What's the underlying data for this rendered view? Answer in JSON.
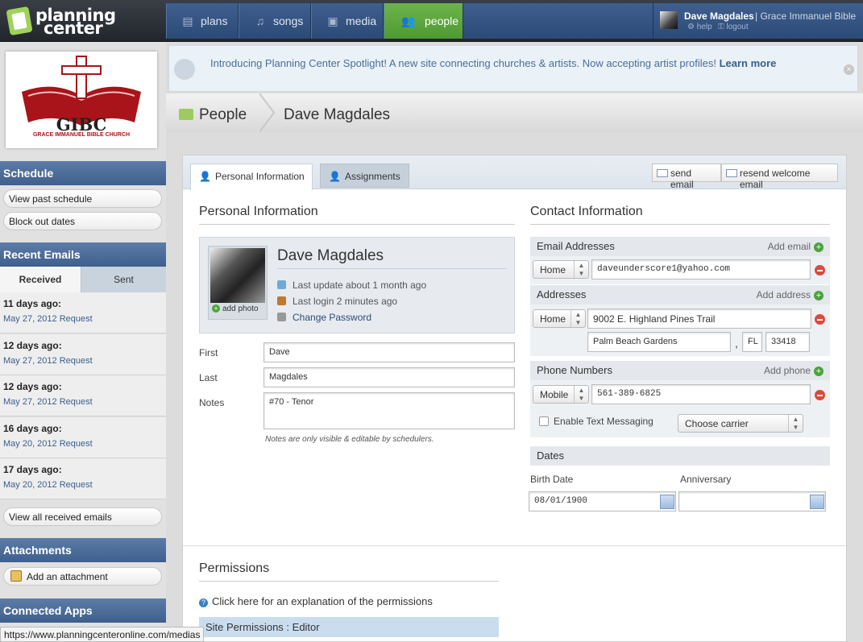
{
  "brand": {
    "line1": "planning",
    "line2": "center"
  },
  "nav": {
    "tabs": [
      {
        "label": "plans"
      },
      {
        "label": "songs"
      },
      {
        "label": "media"
      },
      {
        "label": "people"
      }
    ],
    "user_name": "Dave Magdales",
    "org": "Grace Immanuel Bible",
    "help": "help",
    "logout": "logout"
  },
  "sidebar": {
    "church_logo_text": "GIBC",
    "church_logo_sub": "GRACE IMMANUEL BIBLE CHURCH",
    "schedule_title": "Schedule",
    "view_past_schedule": "View past schedule",
    "block_out_dates": "Block out dates",
    "recent_emails_title": "Recent Emails",
    "tab_received": "Received",
    "tab_sent": "Sent",
    "emails": [
      {
        "ago": "11 days ago:",
        "subject": "May 27, 2012 Request"
      },
      {
        "ago": "12 days ago:",
        "subject": "May 27, 2012 Request"
      },
      {
        "ago": "12 days ago:",
        "subject": "May 27, 2012 Request"
      },
      {
        "ago": "16 days ago:",
        "subject": "May 20, 2012 Request"
      },
      {
        "ago": "17 days ago:",
        "subject": "May 20, 2012 Request"
      }
    ],
    "view_all_emails": "View all received emails",
    "attachments_title": "Attachments",
    "add_attachment": "Add an attachment",
    "connected_apps_title": "Connected Apps"
  },
  "notice": {
    "text": "Introducing Planning Center Spotlight! A new site connecting churches & artists. Now accepting artist profiles!",
    "link": "Learn more",
    "close": "×"
  },
  "breadcrumb": {
    "root": "People",
    "current": "Dave Magdales"
  },
  "tabs": {
    "personal": "Personal Information",
    "assignments": "Assignments"
  },
  "actions": {
    "send_email": "send email",
    "resend_welcome": "resend welcome email"
  },
  "personal": {
    "heading": "Personal Information",
    "name": "Dave Magdales",
    "add_photo": "add photo",
    "last_update": "Last update about 1 month ago",
    "last_login": "Last login 2 minutes ago",
    "change_password": "Change Password",
    "first_label": "First",
    "first_value": "Dave",
    "last_label": "Last",
    "last_value": "Magdales",
    "notes_label": "Notes",
    "notes_value": "#70 - Tenor",
    "notes_hint": "Notes are only visible & editable by schedulers."
  },
  "contact": {
    "heading": "Contact Information",
    "email_header": "Email Addresses",
    "add_email": "Add email",
    "email_type": "Home",
    "email_value": "daveunderscore1@yahoo.com",
    "address_header": "Addresses",
    "add_address": "Add address",
    "address_type": "Home",
    "street": "9002 E. Highland Pines Trail",
    "city": "Palm Beach Gardens",
    "comma": ",",
    "state": "FL",
    "zip": "33418",
    "phone_header": "Phone Numbers",
    "add_phone": "Add phone",
    "phone_type": "Mobile",
    "phone_value": "561-389-6825",
    "text_messaging": "Enable Text Messaging",
    "carrier": "Choose carrier",
    "dates_header": "Dates",
    "birth_label": "Birth Date",
    "birth_value": "08/01/1900",
    "anniversary_label": "Anniversary",
    "anniversary_value": ""
  },
  "permissions": {
    "heading": "Permissions",
    "explain": "Click here for an explanation of the permissions",
    "site": "Site Permissions : Editor"
  },
  "status_url": "https://www.planningcenteronline.com/medias"
}
